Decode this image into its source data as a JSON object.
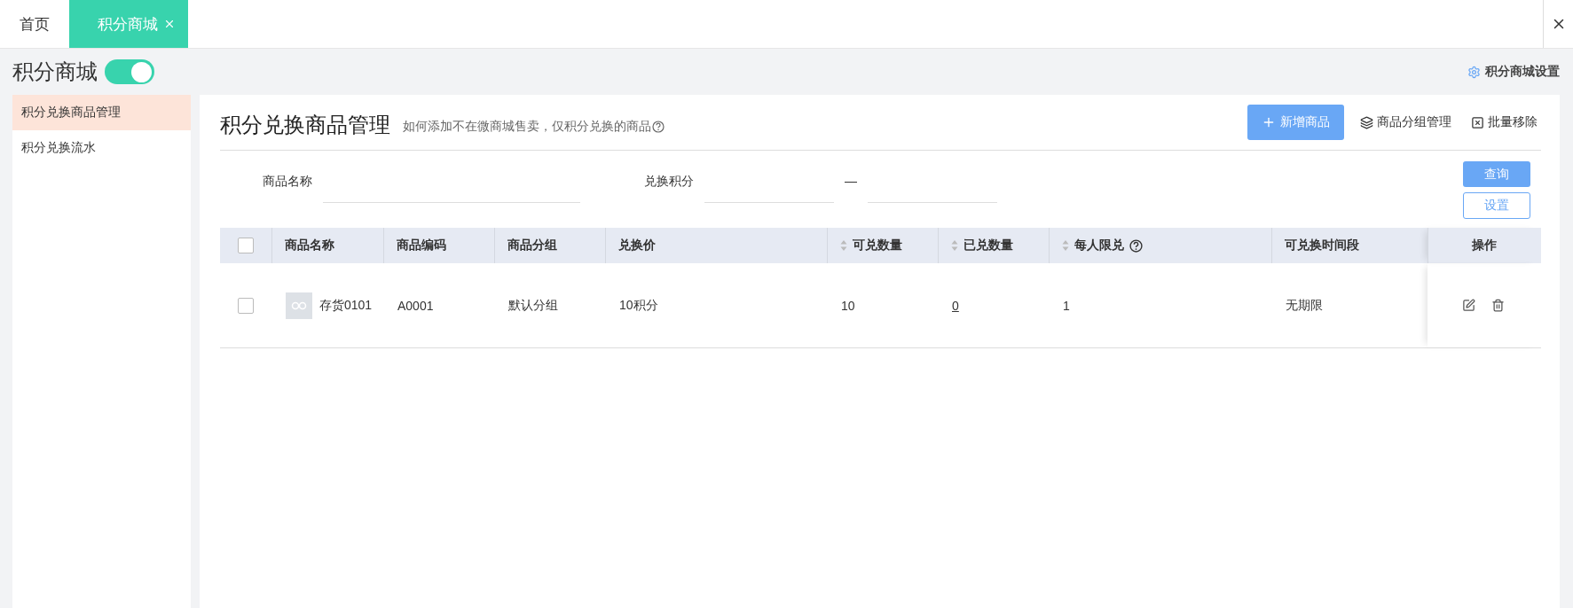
{
  "tabs": [
    {
      "label": "首页",
      "selected": false,
      "closable": false
    },
    {
      "label": "积分商城",
      "selected": true,
      "closable": true
    }
  ],
  "page": {
    "title": "积分商城",
    "enabled": true,
    "settings_link": "积分商城设置"
  },
  "sidebar": {
    "items": [
      {
        "label": "积分兑换商品管理",
        "selected": true
      },
      {
        "label": "积分兑换流水",
        "selected": false
      }
    ]
  },
  "header": {
    "title": "积分兑换商品管理",
    "help_text": "如何添加不在微商城售卖，仅积分兑换的商品",
    "actions": [
      {
        "kind": "primary",
        "label": "新增商品"
      },
      {
        "kind": "group",
        "label": "商品分组管理"
      },
      {
        "kind": "remove",
        "label": "批量移除"
      }
    ]
  },
  "filters": {
    "fields": [
      {
        "label": "商品名称",
        "kind": "single"
      },
      {
        "label": "兑换积分",
        "kind": "range",
        "separator": "—"
      }
    ],
    "query_button": "查询",
    "settings_button": "设置"
  },
  "table": {
    "header_checked": false,
    "columns": [
      {
        "label": "商品名称",
        "sortable": false,
        "help": false
      },
      {
        "label": "商品编码",
        "sortable": false,
        "help": false
      },
      {
        "label": "商品分组",
        "sortable": false,
        "help": false
      },
      {
        "label": "兑换价",
        "sortable": false,
        "help": false
      },
      {
        "label": "可兑数量",
        "sortable": true,
        "help": false
      },
      {
        "label": "已兑数量",
        "sortable": true,
        "help": false
      },
      {
        "label": "每人限兑",
        "sortable": true,
        "help": true
      },
      {
        "label": "可兑换时间段",
        "sortable": false,
        "help": false
      },
      {
        "label": "操作",
        "sortable": false,
        "help": false
      }
    ],
    "rows": [
      {
        "checked": false,
        "cells": [
          {
            "kind": "product",
            "text": "存货0101"
          },
          {
            "kind": "text",
            "text": "A0001"
          },
          {
            "kind": "text",
            "text": "默认分组"
          },
          {
            "kind": "text",
            "text": "10积分"
          },
          {
            "kind": "text",
            "text": "10"
          },
          {
            "kind": "link",
            "text": "0"
          },
          {
            "kind": "text",
            "text": "1"
          },
          {
            "kind": "text",
            "text": "无期限"
          },
          {
            "kind": "actions",
            "text": ""
          }
        ]
      }
    ]
  }
}
